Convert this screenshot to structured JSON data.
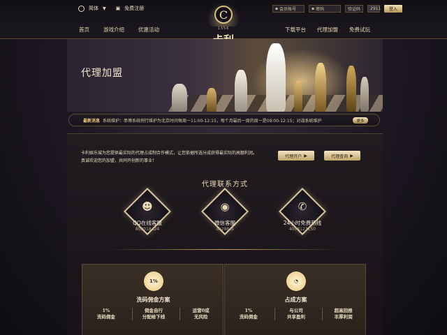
{
  "header": {
    "language": "简体",
    "register": "免费注册",
    "account_placeholder": "会员帐号",
    "password_placeholder": "密码",
    "captcha_label": "验证码",
    "captcha_code": "2911",
    "login": "登入",
    "nav_left": [
      "首页",
      "游戏介绍",
      "优惠活动"
    ],
    "nav_right": [
      "下载平台",
      "代理加盟",
      "免费试玩"
    ],
    "logo_letter": "C",
    "logo_year": "1356",
    "logo_name": "卡利"
  },
  "banner": {
    "title": "代理加盟"
  },
  "ticker": {
    "label": "最新消息",
    "text": "系统维护：串博系统例行维护为北京时间每周一11:00-12:15，每个月最后一周的周一是09:00-12:15；对战系统维护",
    "more": "更多"
  },
  "intro": {
    "line1": "卡利娱乐城为您提供最实际的代理占成制合作模式，让您依据所选分成获得最实际的高额利润。",
    "line2": "真诚欢迎您的加盟，共同开创新的事业！",
    "btn_apply": "代理开户",
    "btn_query": "代理查询"
  },
  "contacts": {
    "title": "代理联系方式",
    "items": [
      {
        "icon": "qq-icon",
        "label": "QQ在线客服",
        "value": "800018424"
      },
      {
        "icon": "wechat-icon",
        "label": "微信客服",
        "value": "ob288cs"
      },
      {
        "icon": "phone-icon",
        "label": "24小时免费热线",
        "value": "4008123150"
      }
    ]
  },
  "plans": [
    {
      "icon_text": "1%",
      "title": "洗码佣金方案",
      "items": [
        [
          "1%",
          "洗码佣金"
        ],
        [
          "佣金自行",
          "分配给下线"
        ],
        [
          "运营0成",
          "无风险"
        ]
      ]
    },
    {
      "icon_text": "◔",
      "title": "占成方案",
      "items": [
        [
          "1%",
          "洗码佣金"
        ],
        [
          "与公司",
          "共享盈利"
        ],
        [
          "超高回报",
          "丰厚利润"
        ]
      ]
    }
  ],
  "colors": {
    "accent_gold": "#d9bd7c",
    "background": "#1d1822"
  }
}
